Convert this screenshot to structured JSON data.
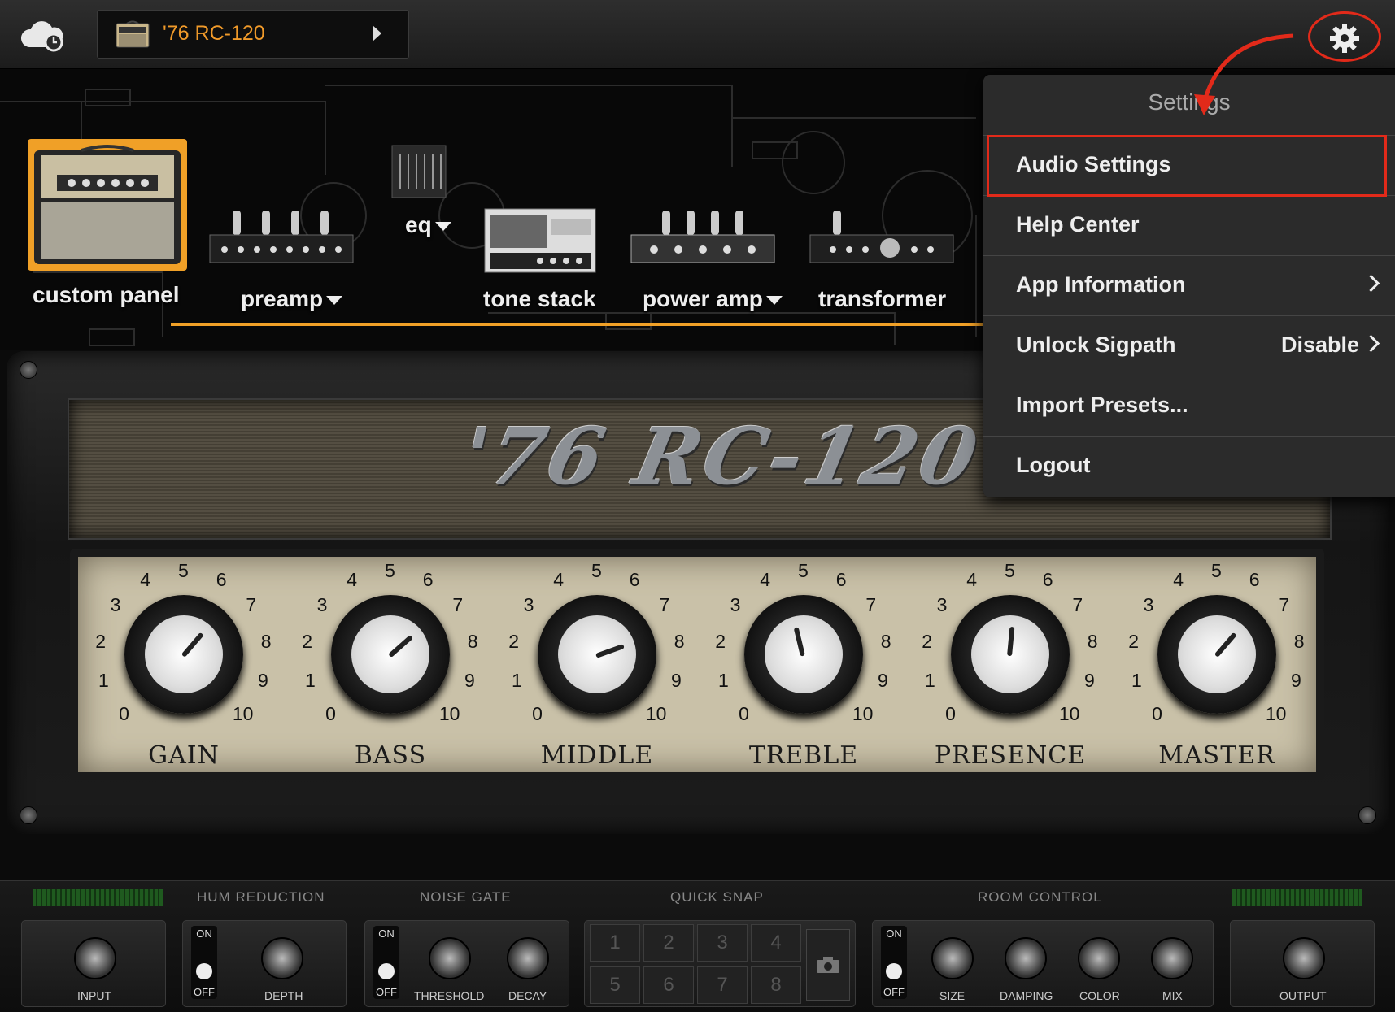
{
  "topbar": {
    "preset_name": "'76 RC-120",
    "cloud_icon": "cloud-sync-icon",
    "settings_icon": "gear-icon"
  },
  "chain": {
    "modules": [
      {
        "label": "custom panel",
        "dropdown": false
      },
      {
        "label": "preamp",
        "dropdown": true
      },
      {
        "label": "eq",
        "dropdown": true
      },
      {
        "label": "tone stack",
        "dropdown": false
      },
      {
        "label": "power amp",
        "dropdown": true
      },
      {
        "label": "transformer",
        "dropdown": false
      }
    ],
    "accent_color": "#f0a027"
  },
  "amp": {
    "logo": "'76 RC-120",
    "scale": [
      "0",
      "1",
      "2",
      "3",
      "4",
      "5",
      "6",
      "7",
      "8",
      "9",
      "10"
    ],
    "knobs": [
      {
        "label": "GAIN",
        "value": 6.5
      },
      {
        "label": "BASS",
        "value": 6.8
      },
      {
        "label": "MIDDLE",
        "value": 7.6
      },
      {
        "label": "TREBLE",
        "value": 4.5
      },
      {
        "label": "PRESENCE",
        "value": 5.2
      },
      {
        "label": "MASTER",
        "value": 6.5
      }
    ]
  },
  "menu": {
    "title": "Settings",
    "items": [
      {
        "label": "Audio Settings",
        "value": "",
        "chevron": false,
        "highlighted": true
      },
      {
        "label": "Help Center",
        "value": "",
        "chevron": false
      },
      {
        "label": "App Information",
        "value": "",
        "chevron": true
      },
      {
        "label": "Unlock Sigpath",
        "value": "Disable",
        "chevron": true
      },
      {
        "label": "Import Presets...",
        "value": "",
        "chevron": false
      },
      {
        "label": "Logout",
        "value": "",
        "chevron": false
      }
    ],
    "highlight_color": "#e22a1a"
  },
  "bottom": {
    "sections": {
      "hum_reduction": "HUM REDUCTION",
      "noise_gate": "NOISE GATE",
      "quick_snap": "QUICK SNAP",
      "room_control": "ROOM CONTROL"
    },
    "switch": {
      "on": "ON",
      "off": "OFF"
    },
    "knobs": {
      "input": "INPUT",
      "depth": "DEPTH",
      "threshold": "THRESHOLD",
      "decay": "DECAY",
      "size": "SIZE",
      "damping": "DAMPING",
      "color": "COLOR",
      "mix": "MIX",
      "output": "OUTPUT"
    },
    "snap_slots": [
      "1",
      "2",
      "3",
      "4",
      "5",
      "6",
      "7",
      "8"
    ],
    "camera_icon": "camera-icon"
  }
}
